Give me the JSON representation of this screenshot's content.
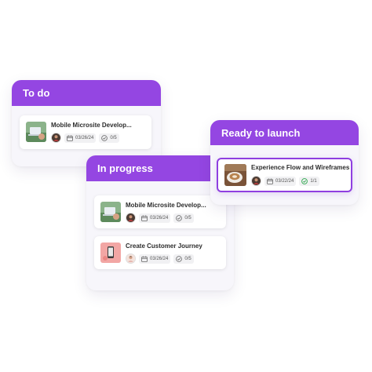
{
  "columns": {
    "todo": {
      "title": "To do",
      "cards": [
        {
          "title": "Mobile Microsite Develop...",
          "date": "03/26/24",
          "progress": "0/5",
          "thumb": "laptop-photo"
        }
      ]
    },
    "in_progress": {
      "title": "In progress",
      "cards": [
        {
          "title": "Mobile Microsite Develop...",
          "date": "03/26/24",
          "progress": "0/5",
          "thumb": "laptop-photo"
        },
        {
          "title": "Create Customer Journey",
          "date": "03/26/24",
          "progress": "0/5",
          "thumb": "phone-photo"
        }
      ]
    },
    "ready": {
      "title": "Ready to launch",
      "cards": [
        {
          "title": "Experience Flow and Wireframes",
          "date": "03/22/24",
          "progress": "1/1",
          "thumb": "coffee-photo"
        }
      ]
    }
  },
  "colors": {
    "accent": "#9446e2",
    "complete": "#2fa84f"
  }
}
